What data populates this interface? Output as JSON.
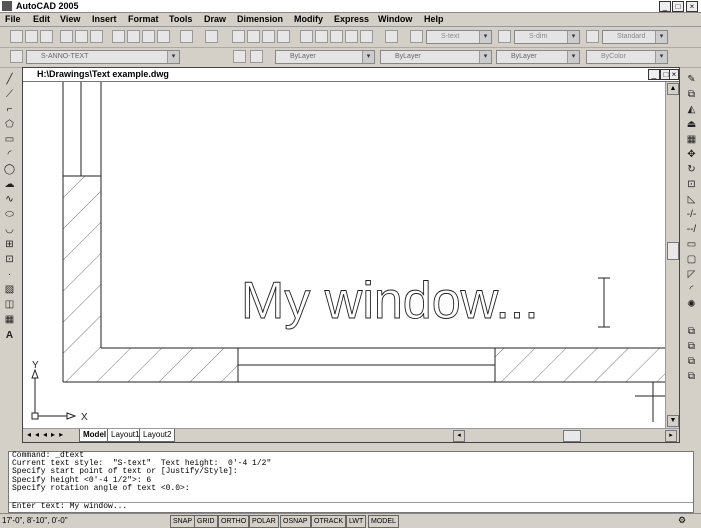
{
  "app": {
    "title": "AutoCAD 2005"
  },
  "menu": [
    "File",
    "Edit",
    "View",
    "Insert",
    "Format",
    "Tools",
    "Draw",
    "Dimension",
    "Modify",
    "Express",
    "Window",
    "Help"
  ],
  "toolbar": {
    "layer": "S-ANNO-TEXT",
    "text_style": "S-text",
    "dim_style": "S-dim",
    "table_style": "Standard",
    "color": "ByLayer",
    "linetype": "ByLayer",
    "lineweight": "ByLayer",
    "plotstyle": "ByColor"
  },
  "drawing": {
    "window_title": "H:\\Drawings\\Text example.dwg",
    "text": "My window...",
    "ucs_y": "Y",
    "ucs_x": "X"
  },
  "tabs": [
    "Model",
    "Layout1",
    "Layout2"
  ],
  "command": {
    "lines": [
      "Command: _dtext",
      "Current text style:  \"S-text\"  Text height:  0'-4 1/2\"",
      "Specify start point of text or [Justify/Style]:",
      "Specify height <0'-4 1/2\">: 6",
      "Specify rotation angle of text <0.0>:"
    ],
    "input": "Enter text: My window..."
  },
  "status": {
    "coords": "17'-0\", 8'-10\", 0'-0\"",
    "buttons": [
      "SNAP",
      "GRID",
      "ORTHO",
      "POLAR",
      "OSNAP",
      "OTRACK",
      "LWT",
      "MODEL"
    ]
  }
}
